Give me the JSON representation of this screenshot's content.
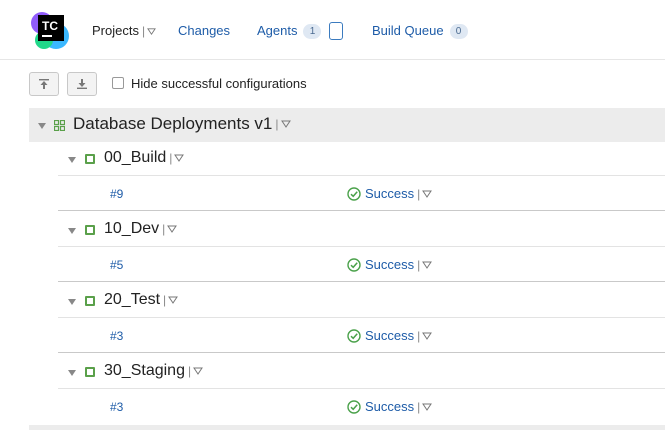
{
  "header": {
    "logo_text": "TC",
    "nav": {
      "projects": "Projects",
      "changes": "Changes",
      "agents": "Agents",
      "agents_count": "1",
      "build_queue": "Build Queue",
      "build_queue_count": "0"
    },
    "separator": "|"
  },
  "toolbar": {
    "hide_successful_label": "Hide successful configurations",
    "hide_successful_checked": false
  },
  "project": {
    "title": "Database Deployments v1",
    "build_configs": [
      {
        "name": "00_Build",
        "build_number": "#9",
        "status": "Success"
      },
      {
        "name": "10_Dev",
        "build_number": "#5",
        "status": "Success"
      },
      {
        "name": "20_Test",
        "build_number": "#3",
        "status": "Success"
      },
      {
        "name": "30_Staging",
        "build_number": "#3",
        "status": "Success"
      }
    ]
  },
  "colors": {
    "link": "#1e5ca8",
    "success": "#4aa14a",
    "project_row_bg": "#ececec"
  }
}
